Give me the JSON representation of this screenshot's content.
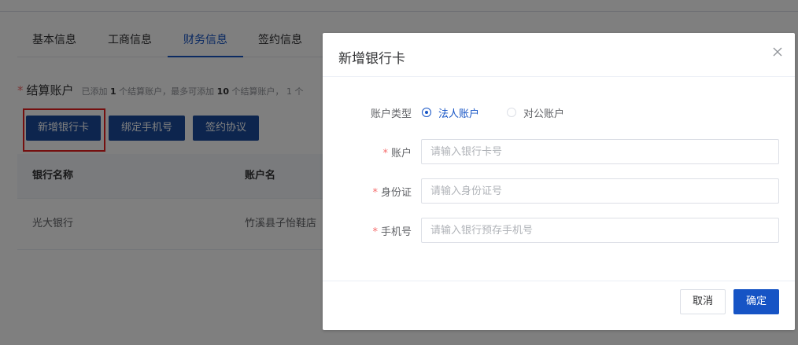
{
  "tabs": [
    {
      "label": "基本信息"
    },
    {
      "label": "工商信息"
    },
    {
      "label": "财务信息"
    },
    {
      "label": "签约信息"
    }
  ],
  "active_tab": "财务信息",
  "section": {
    "required_mark": "*",
    "title": "结算账户",
    "note_prefix": "已添加",
    "added_count": "1",
    "note_mid": "个结算账户，最多可添加",
    "max_count": "10",
    "note_suffix": "个结算账户，",
    "note_tail": "1 个"
  },
  "actions": {
    "add_bank_card": "新增银行卡",
    "bind_phone": "绑定手机号",
    "sign_agreement": "签约协议"
  },
  "table": {
    "columns": [
      "银行名称",
      "账户名"
    ],
    "rows": [
      {
        "bank_name": "光大银行",
        "account_name": "竹溪县子怡鞋店"
      }
    ]
  },
  "dialog": {
    "title": "新增银行卡",
    "close_icon": "close-icon",
    "account_type_label": "账户类型",
    "account_type_options": [
      "法人账户",
      "对公账户"
    ],
    "account_type_selected": "法人账户",
    "account_label": "账户",
    "account_placeholder": "请输入银行卡号",
    "id_label": "身份证",
    "id_placeholder": "请输入身份证号",
    "phone_label": "手机号",
    "phone_placeholder": "请输入银行预存手机号",
    "cancel": "取消",
    "confirm": "确定"
  },
  "colors": {
    "primary": "#1654c5",
    "dark_button": "#1a4b9c",
    "required": "#f56c6c",
    "highlight_box": "#e81e1e"
  }
}
